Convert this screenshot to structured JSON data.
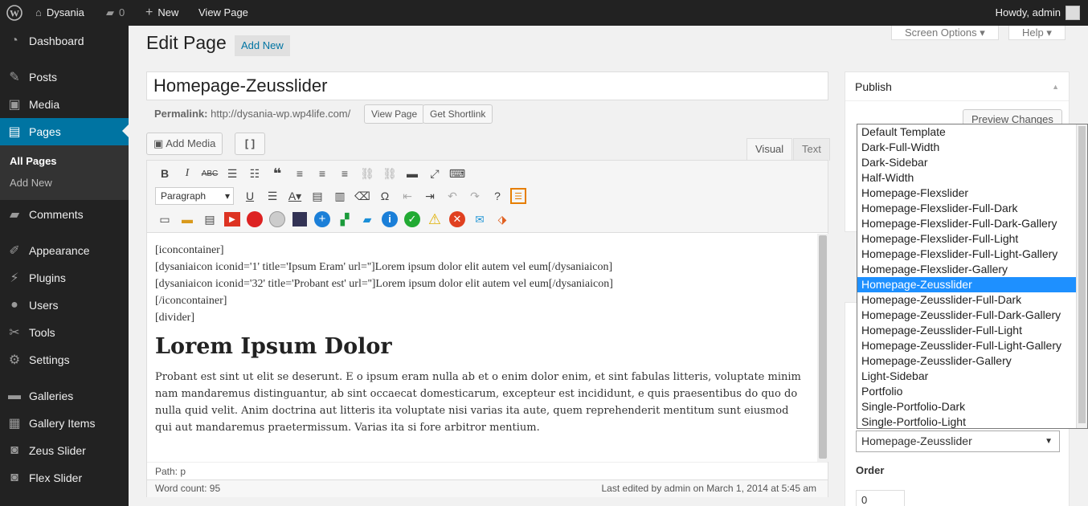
{
  "adminbar": {
    "site_name": "Dysania",
    "comments_count": "0",
    "new_label": "New",
    "view_page_label": "View Page",
    "howdy": "Howdy, admin"
  },
  "sidebar": {
    "items": [
      {
        "label": "Dashboard",
        "icon": "dashboard-icon"
      },
      {
        "label": "Posts",
        "icon": "pin-icon"
      },
      {
        "label": "Media",
        "icon": "media-icon"
      },
      {
        "label": "Pages",
        "icon": "page-icon"
      },
      {
        "label": "Comments",
        "icon": "comment-icon"
      },
      {
        "label": "Appearance",
        "icon": "brush-icon"
      },
      {
        "label": "Plugins",
        "icon": "plug-icon"
      },
      {
        "label": "Users",
        "icon": "user-icon"
      },
      {
        "label": "Tools",
        "icon": "wrench-icon"
      },
      {
        "label": "Settings",
        "icon": "settings-icon"
      },
      {
        "label": "Galleries",
        "icon": "folder-icon"
      },
      {
        "label": "Gallery Items",
        "icon": "gallery-icon"
      },
      {
        "label": "Zeus Slider",
        "icon": "camera-icon"
      },
      {
        "label": "Flex Slider",
        "icon": "camera-icon"
      }
    ],
    "submenu": [
      "All Pages",
      "Add New"
    ]
  },
  "header": {
    "title": "Edit Page",
    "add_new": "Add New",
    "screen_options": "Screen Options",
    "help": "Help"
  },
  "post": {
    "title": "Homepage-Zeusslider",
    "permalink_label": "Permalink:",
    "permalink_url": "http://dysania-wp.wp4life.com/",
    "view_page": "View Page",
    "get_shortlink": "Get Shortlink"
  },
  "editor": {
    "add_media": "Add Media",
    "shortcode_btn": "[ ]",
    "tab_visual": "Visual",
    "tab_text": "Text",
    "format": "Paragraph",
    "content": {
      "line1": "[iconcontainer]",
      "line2": "[dysaniaicon iconid='1' title='Ipsum Eram' url='']Lorem ipsum dolor elit autem vel eum[/dysaniaicon]",
      "line3": "[dysaniaicon iconid='32' title='Probant est' url='']Lorem ipsum dolor elit autem vel eum[/dysaniaicon]",
      "line4": "[/iconcontainer]",
      "line5": "[divider]",
      "heading": "Lorem Ipsum Dolor",
      "paragraph": "Probant est sint ut elit se deserunt. E o ipsum eram nulla ab et o enim dolor enim, et sint fabulas litteris, voluptate minim nam mandaremus distinguantur, ab sint occaecat domesticarum, excepteur est incididunt, e quis praesentibus do quo do nulla quid velit. Anim doctrina aut litteris ita voluptate nisi varias ita aute, quem reprehenderit mentitum sunt eiusmod qui aut mandaremus praetermissum. Varias ita si fore arbitror mentium."
    },
    "path": "Path: p",
    "word_count": "Word count: 95",
    "last_edited": "Last edited by admin on March 1, 2014 at 5:45 am"
  },
  "publish": {
    "title": "Publish",
    "preview_changes": "Preview Changes"
  },
  "attributes": {
    "template_selected": "Homepage-Zeusslider",
    "template_options": [
      "Default Template",
      "Dark-Full-Width",
      "Dark-Sidebar",
      "Half-Width",
      "Homepage-Flexslider",
      "Homepage-Flexslider-Full-Dark",
      "Homepage-Flexslider-Full-Dark-Gallery",
      "Homepage-Flexslider-Full-Light",
      "Homepage-Flexslider-Full-Light-Gallery",
      "Homepage-Flexslider-Gallery",
      "Homepage-Zeusslider",
      "Homepage-Zeusslider-Full-Dark",
      "Homepage-Zeusslider-Full-Dark-Gallery",
      "Homepage-Zeusslider-Full-Light",
      "Homepage-Zeusslider-Full-Light-Gallery",
      "Homepage-Zeusslider-Gallery",
      "Light-Sidebar",
      "Portfolio",
      "Single-Portfolio-Dark",
      "Single-Portfolio-Light"
    ],
    "order_label": "Order",
    "order_value": "0"
  },
  "colors": {
    "admin_bg": "#222222",
    "accent": "#0074a2",
    "selected_option": "#1e90ff"
  }
}
